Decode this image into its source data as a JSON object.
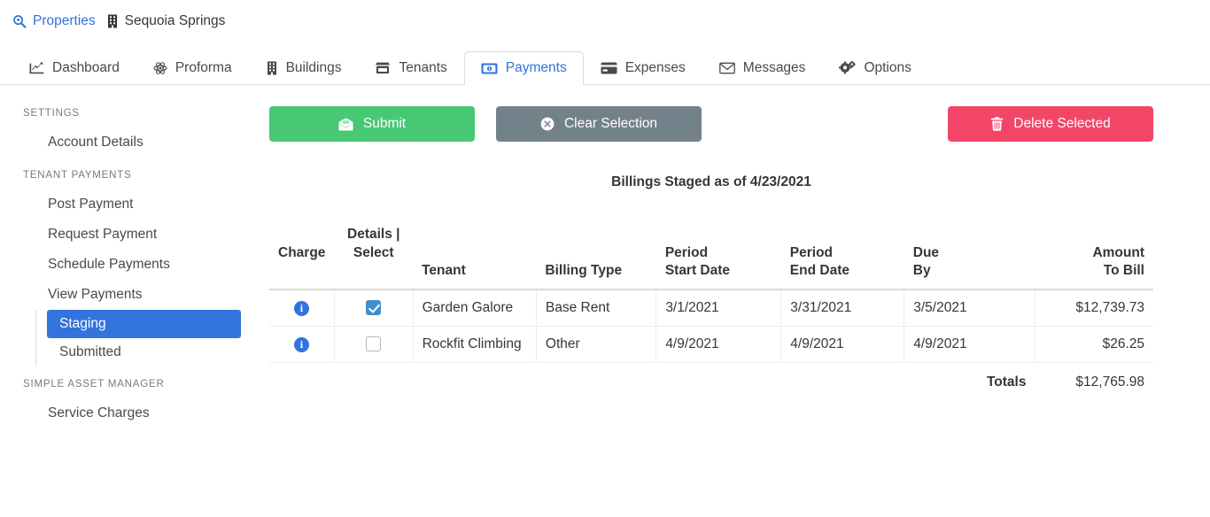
{
  "breadcrumb": {
    "items": [
      {
        "icon": "search-location-icon",
        "label": "Properties",
        "link": true
      },
      {
        "icon": "building-icon",
        "label": "Sequoia Springs",
        "link": false
      }
    ]
  },
  "tabs": [
    {
      "icon": "chart-line-icon",
      "label": "Dashboard",
      "active": false
    },
    {
      "icon": "atom-icon",
      "label": "Proforma",
      "active": false
    },
    {
      "icon": "building-icon",
      "label": "Buildings",
      "active": false
    },
    {
      "icon": "store-icon",
      "label": "Tenants",
      "active": false
    },
    {
      "icon": "money-bill-icon",
      "label": "Payments",
      "active": true
    },
    {
      "icon": "credit-card-icon",
      "label": "Expenses",
      "active": false
    },
    {
      "icon": "envelope-icon",
      "label": "Messages",
      "active": false
    },
    {
      "icon": "cogs-icon",
      "label": "Options",
      "active": false
    }
  ],
  "sidebar": {
    "groups": [
      {
        "label": "SETTINGS",
        "items": [
          {
            "label": "Account Details"
          }
        ]
      },
      {
        "label": "TENANT PAYMENTS",
        "items": [
          {
            "label": "Post Payment"
          },
          {
            "label": "Request Payment"
          },
          {
            "label": "Schedule Payments"
          },
          {
            "label": "View Payments"
          }
        ],
        "sub_items": [
          {
            "label": "Staging",
            "active": true
          },
          {
            "label": "Submitted",
            "active": false
          }
        ]
      },
      {
        "label": "SIMPLE ASSET MANAGER",
        "items": [
          {
            "label": "Service Charges"
          }
        ]
      }
    ]
  },
  "toolbar": {
    "submit_label": "Submit",
    "submit_icon": "envelope-open-text-icon",
    "submit_color": "#48c774",
    "clear_label": "Clear Selection",
    "clear_icon": "times-circle-icon",
    "clear_color": "#73818a",
    "delete_label": "Delete Selected",
    "delete_icon": "trash-icon",
    "delete_color": "#f14668"
  },
  "table": {
    "title": "Billings Staged as of 4/23/2021",
    "headers": {
      "charge_details_select": "Charge\nDetails | Select",
      "charge_line1": "Charge",
      "charge_line2_details": "Details | Select",
      "tenant": "Tenant",
      "billing_type": "Billing Type",
      "period_start": "Period\nStart Date",
      "period_end": "Period\nEnd Date",
      "due_by": "Due\nBy",
      "amount_to_bill": "Amount\nTo Bill"
    },
    "rows": [
      {
        "info": "i",
        "selected": true,
        "tenant": "Garden Galore",
        "billing_type": "Base Rent",
        "period_start": "3/1/2021",
        "period_end": "3/31/2021",
        "due_by": "3/5/2021",
        "amount": "$12,739.73"
      },
      {
        "info": "i",
        "selected": false,
        "tenant": "Rockfit Climbing",
        "billing_type": "Other",
        "period_start": "4/9/2021",
        "period_end": "4/9/2021",
        "due_by": "4/9/2021",
        "amount": "$26.25"
      }
    ],
    "totals": {
      "label": "Totals",
      "value": "$12,765.98"
    }
  },
  "colors": {
    "accent_blue": "#3273dc",
    "text": "#363636",
    "muted": "#7a7a7a",
    "border": "#dbdbdb"
  }
}
